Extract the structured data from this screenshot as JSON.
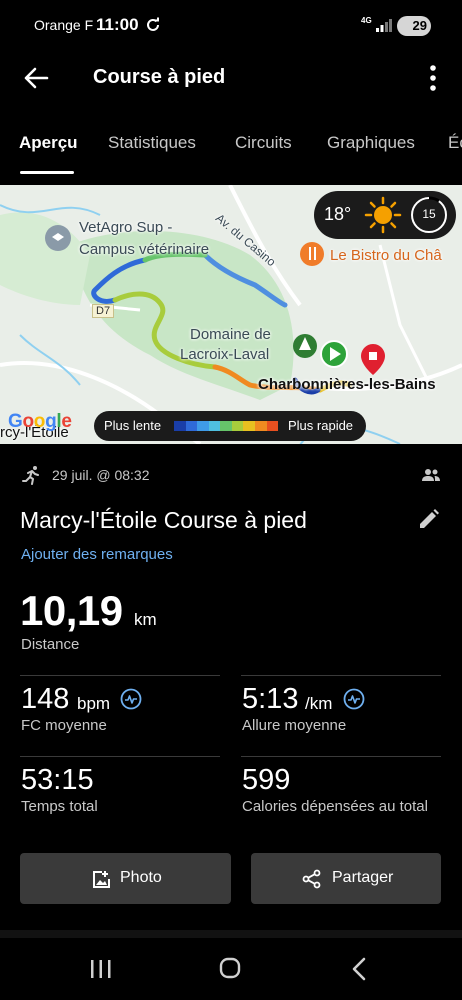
{
  "status_bar": {
    "carrier": "Orange F",
    "time": "11:00",
    "network": "4G",
    "battery": "29"
  },
  "app_bar": {
    "title": "Course à pied"
  },
  "tabs": [
    {
      "label": "Aperçu",
      "active": true
    },
    {
      "label": "Statistiques",
      "active": false
    },
    {
      "label": "Circuits",
      "active": false
    },
    {
      "label": "Graphiques",
      "active": false
    },
    {
      "label": "Éc",
      "active": false
    }
  ],
  "map": {
    "labels": {
      "vetagro": "VetAgro Sup -",
      "campus": "Campus vétérinaire",
      "avenue": "Av. du Casino",
      "bistro": "Le Bistro du Châ",
      "d7": "D7",
      "domaine": "Domaine de",
      "lacroix": "Lacroix-Laval",
      "charbonnieres": "Charbonnières-les-Bains",
      "marcy": "rcy-l'Étoile"
    },
    "weather": {
      "temperature": "18°",
      "aqi": "15",
      "icon": "sun-icon"
    },
    "legend": {
      "slow": "Plus lente",
      "fast": "Plus rapide",
      "colors": [
        "#1a3ea8",
        "#2f6ad8",
        "#3f9be8",
        "#4fc0e0",
        "#66c46a",
        "#a8cc3c",
        "#e8c020",
        "#f08a20",
        "#e85020"
      ]
    },
    "attribution": "Google"
  },
  "activity": {
    "date": "29 juil. @ 08:32",
    "title": "Marcy-l'Étoile Course à pied",
    "add_notes": "Ajouter des remarques",
    "distance": {
      "value": "10,19",
      "unit": "km",
      "label": "Distance"
    },
    "heart_rate": {
      "value": "148",
      "unit": "bpm",
      "label": "FC moyenne"
    },
    "pace": {
      "value": "5:13",
      "unit": "/km",
      "label": "Allure moyenne"
    },
    "total_time": {
      "value": "53:15",
      "label": "Temps total"
    },
    "calories": {
      "value": "599",
      "label": "Calories dépensées au total"
    }
  },
  "actions": {
    "photo": "Photo",
    "share": "Partager"
  }
}
